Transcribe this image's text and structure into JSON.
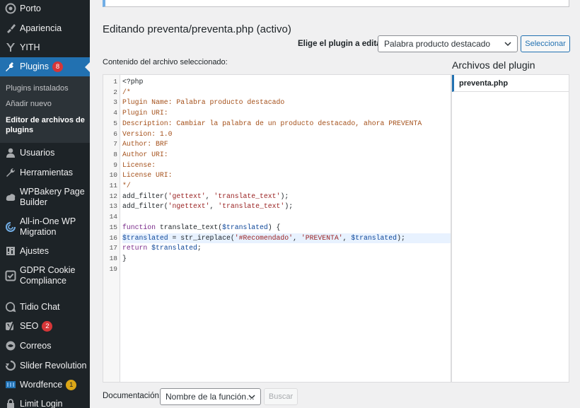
{
  "sidebar": {
    "items": [
      {
        "label": "Porto",
        "icon": "porto-icon"
      },
      {
        "label": "Apariencia",
        "icon": "paintbrush-icon"
      },
      {
        "label": "YITH",
        "icon": "yith-icon"
      },
      {
        "label": "Plugins",
        "icon": "plugins-icon",
        "badge": "8"
      },
      {
        "label": "Usuarios",
        "icon": "users-icon"
      },
      {
        "label": "Herramientas",
        "icon": "wrench-icon"
      },
      {
        "label": "WPBakery Page Builder",
        "icon": "wpbakery-icon"
      },
      {
        "label": "All-in-One WP Migration",
        "icon": "migration-icon"
      },
      {
        "label": "Ajustes",
        "icon": "settings-icon"
      },
      {
        "label": "GDPR Cookie Compliance",
        "icon": "gdpr-icon"
      },
      {
        "label": "Tidio Chat",
        "icon": "chat-icon"
      },
      {
        "label": "SEO",
        "icon": "yoast-icon",
        "badge": "2"
      },
      {
        "label": "Correos",
        "icon": "correos-icon"
      },
      {
        "label": "Slider Revolution",
        "icon": "slider-icon"
      },
      {
        "label": "Wordfence",
        "icon": "wordfence-icon",
        "badge": "1"
      },
      {
        "label": "Limit Login",
        "icon": "lock-icon"
      }
    ],
    "submenu": [
      {
        "label": "Plugins instalados"
      },
      {
        "label": "Añadir nuevo"
      },
      {
        "label": "Editor de archivos de plugins"
      }
    ]
  },
  "main": {
    "title": "Editando preventa/preventa.php (activo)",
    "chooser_label": "Elige el plugin a editar:",
    "plugin_select_value": "Palabra producto destacado",
    "select_button": "Seleccionar",
    "content_label": "Contenido del archivo seleccionado:",
    "files_title": "Archivos del plugin",
    "file_item": "preventa.php",
    "docs_label": "Documentación:",
    "docs_select_value": "Nombre de la función…",
    "search_button": "Buscar"
  },
  "code": {
    "lines": [
      "<?php",
      "/*",
      "Plugin Name: Palabra producto destacado",
      "Plugin URI:",
      "Description: Cambiar la palabra de un producto destacado, ahora PREVENTA",
      "Version: 1.0",
      "Author: BRF",
      "Author URI:",
      "License:",
      "License URI:",
      "*/",
      "add_filter('gettext', 'translate_text');",
      "add_filter('ngettext', 'translate_text');",
      "",
      "function translate_text($translated) {",
      "$translated = str_ireplace('#Recomendado', 'PREVENTA', $translated);",
      "return $translated;",
      "}",
      ""
    ],
    "active_line": 16
  },
  "colors": {
    "sidebar_bg": "#1d2327",
    "accent": "#2271b1",
    "badge_red": "#d63638",
    "badge_orange": "#dba617"
  }
}
